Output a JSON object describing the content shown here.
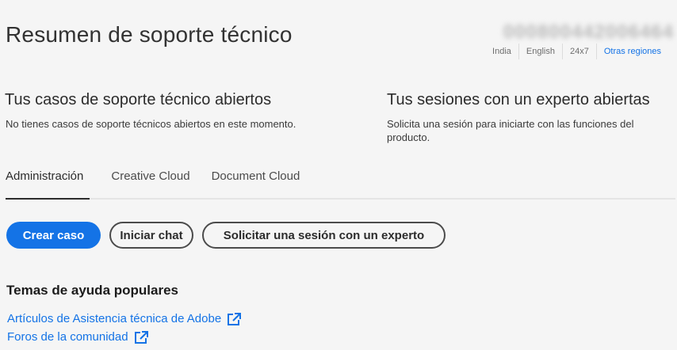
{
  "header": {
    "title": "Resumen de soporte técnico",
    "phone_blurred": "000800442006464",
    "regions": [
      "India",
      "English",
      "24x7"
    ],
    "other_regions_link": "Otras regiones"
  },
  "cases": {
    "title": "Tus casos de soporte técnico abiertos",
    "text": "No tienes casos de soporte técnicos abiertos en este momento."
  },
  "sessions": {
    "title": "Tus sesiones con un experto abiertas",
    "text": "Solicita una sesión para iniciarte con las funciones del producto."
  },
  "tabs": [
    {
      "label": "Administración",
      "active": true
    },
    {
      "label": "Creative Cloud",
      "active": false
    },
    {
      "label": "Document Cloud",
      "active": false
    }
  ],
  "actions": {
    "create_case": "Crear caso",
    "start_chat": "Iniciar chat",
    "request_session": "Solicitar una sesión con un experto"
  },
  "help": {
    "title": "Temas de ayuda populares",
    "links": [
      {
        "label": "Artículos de Asistencia técnica de Adobe",
        "icon": "external-link-icon"
      },
      {
        "label": "Foros de la comunidad",
        "icon": "external-link-icon"
      }
    ]
  },
  "colors": {
    "accent": "#1473e6",
    "background": "#f5f5f5",
    "text": "#2c2c2c"
  }
}
